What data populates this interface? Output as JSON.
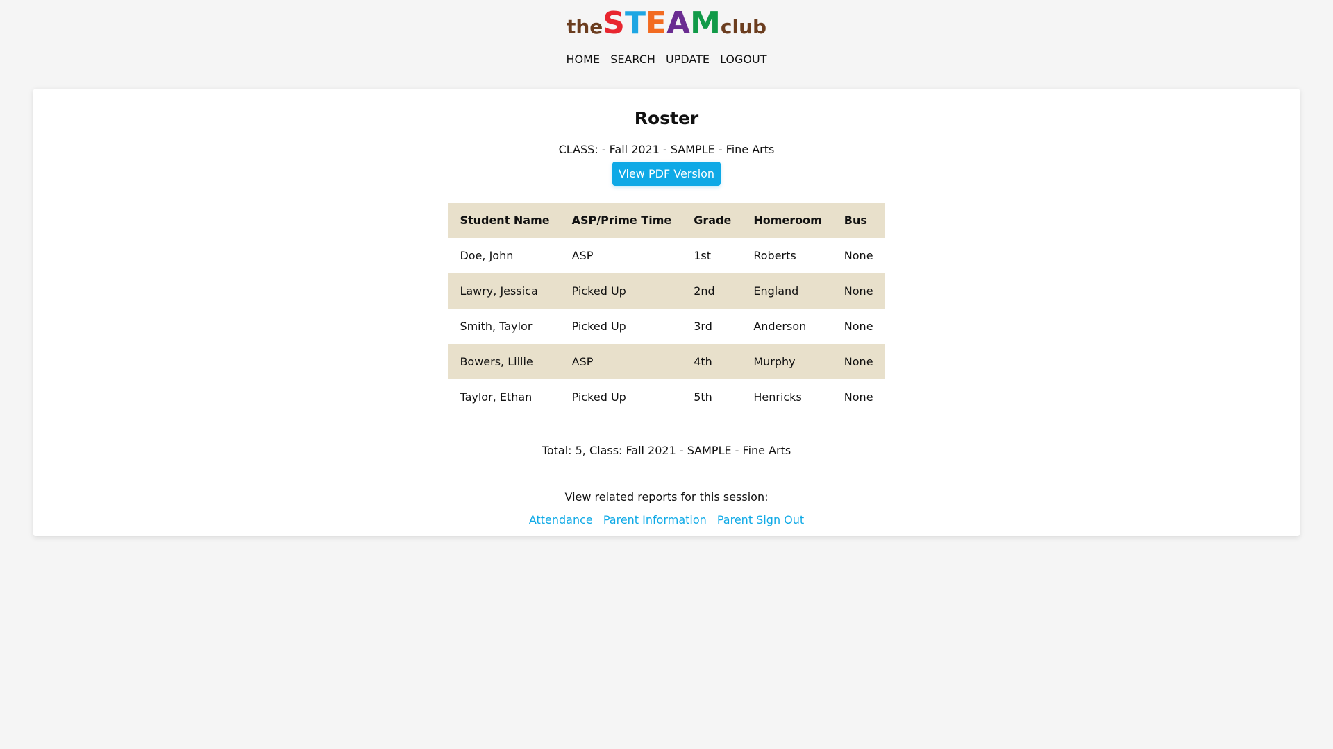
{
  "logo": {
    "the": "the",
    "letters": [
      {
        "char": "S",
        "color": "#e8262f"
      },
      {
        "char": "T",
        "color": "#1ea6e3"
      },
      {
        "char": "E",
        "color": "#f26b21"
      },
      {
        "char": "A",
        "color": "#6a2c91"
      },
      {
        "char": "M",
        "color": "#119a48"
      }
    ],
    "club": "club",
    "brand_brown": "#6b3d1f"
  },
  "nav": {
    "items": [
      "HOME",
      "SEARCH",
      "UPDATE",
      "LOGOUT"
    ]
  },
  "main": {
    "title": "Roster",
    "class_line": "CLASS: - Fall 2021 - SAMPLE - Fine Arts",
    "pdf_button_label": "View PDF Version",
    "table": {
      "headers": [
        "Student Name",
        "ASP/Prime Time",
        "Grade",
        "Homeroom",
        "Bus"
      ],
      "rows": [
        [
          "Doe, John",
          "ASP",
          "1st",
          "Roberts",
          "None"
        ],
        [
          "Lawry, Jessica",
          "Picked Up",
          "2nd",
          "England",
          "None"
        ],
        [
          "Smith, Taylor",
          "Picked Up",
          "3rd",
          "Anderson",
          "None"
        ],
        [
          "Bowers, Lillie",
          "ASP",
          "4th",
          "Murphy",
          "None"
        ],
        [
          "Taylor, Ethan",
          "Picked Up",
          "5th",
          "Henricks",
          "None"
        ]
      ]
    },
    "total_line": "Total: 5, Class: Fall 2021 - SAMPLE - Fine Arts",
    "related_label": "View related reports for this session:",
    "related_links": [
      "Attendance",
      "Parent Information",
      "Parent Sign Out"
    ]
  },
  "colors": {
    "accent": "#0ea9e6",
    "stripe": "#e8e0cb",
    "background": "#f5f5f5"
  }
}
